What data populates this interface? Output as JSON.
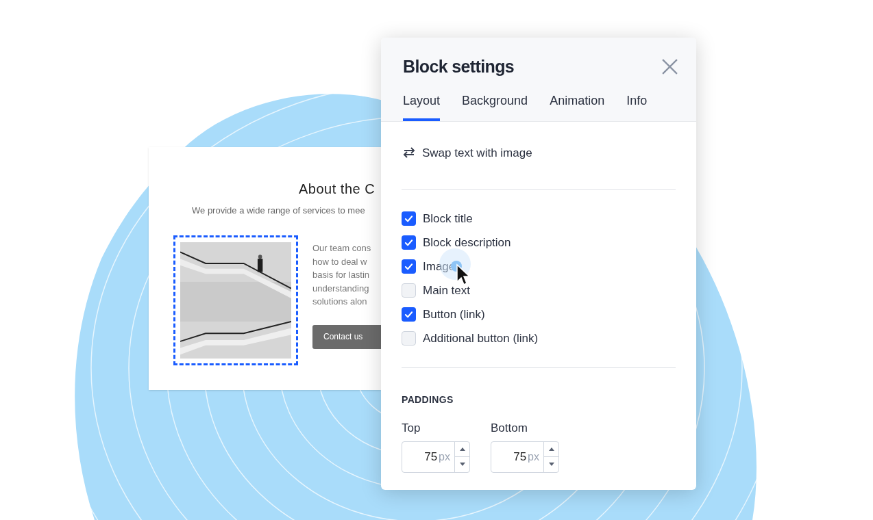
{
  "preview_card": {
    "title": "About the C",
    "subtitle": "We provide a wide range of services to mee",
    "image": {
      "kind": "picture",
      "selected": true
    },
    "paragraph_lines": [
      "Our team cons",
      "how to deal w",
      "basis for lastin",
      "understanding",
      "solutions alon"
    ],
    "button": "Contact us"
  },
  "settings_panel": {
    "title": "Block settings",
    "tabs": [
      {
        "label": "Layout",
        "selected": true
      },
      {
        "label": "Background",
        "selected": false
      },
      {
        "label": "Animation",
        "selected": false
      },
      {
        "label": "Info",
        "selected": false
      }
    ],
    "swap_action": "Swap text with image",
    "options": [
      {
        "label": "Block title",
        "checked": true
      },
      {
        "label": "Block description",
        "checked": true
      },
      {
        "label": "Image",
        "checked": true
      },
      {
        "label": "Main text",
        "checked": false
      },
      {
        "label": "Button (link)",
        "checked": true
      },
      {
        "label": "Additional button (link)",
        "checked": false
      }
    ],
    "paddings": {
      "heading": "PADDINGS",
      "fields": [
        {
          "label": "Top",
          "value": "75",
          "unit": "px"
        },
        {
          "label": "Bottom",
          "value": "75",
          "unit": "px"
        }
      ]
    }
  }
}
